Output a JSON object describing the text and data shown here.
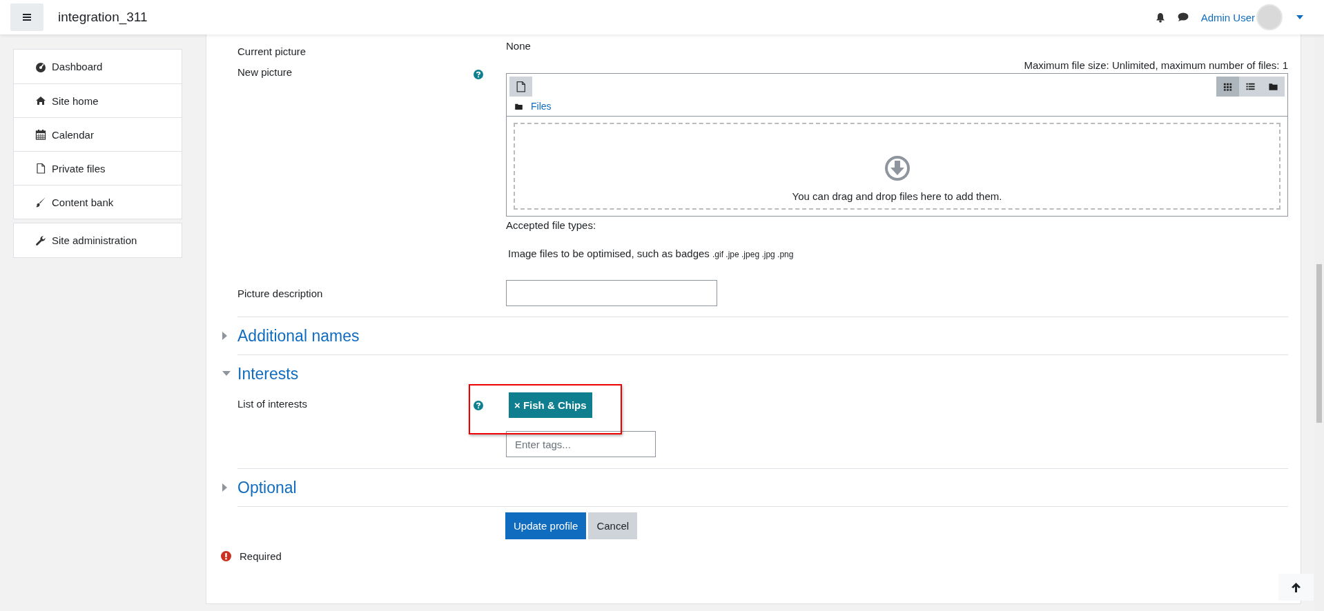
{
  "navbar": {
    "site_name": "integration_311",
    "user_name": "Admin User"
  },
  "sidebar": {
    "groups": [
      [
        {
          "label": "Dashboard",
          "kind": "dashboard"
        },
        {
          "label": "Site home",
          "kind": "home"
        },
        {
          "label": "Calendar",
          "kind": "calendar"
        },
        {
          "label": "Private files",
          "kind": "file"
        },
        {
          "label": "Content bank",
          "kind": "brush"
        }
      ],
      [
        {
          "label": "Site administration",
          "kind": "wrench"
        }
      ]
    ]
  },
  "form": {
    "current_picture": {
      "label": "Current picture",
      "value": "None"
    },
    "new_picture": {
      "label": "New picture",
      "limits": "Maximum file size: Unlimited, maximum number of files: 1",
      "breadcrumb": "Files",
      "view_modes": [
        {
          "kind": "grid",
          "selected": true
        },
        {
          "kind": "list",
          "selected": false
        },
        {
          "kind": "tree",
          "selected": false
        }
      ],
      "drop_text": "You can drag and drop files here to add them.",
      "accepted_label": "Accepted file types:",
      "accepted_types": "Image files to be optimised, such as badges",
      "extensions": ".gif .jpe .jpeg .jpg .png"
    },
    "picture_description": {
      "label": "Picture description"
    },
    "sections": [
      {
        "title": "Additional names",
        "expanded": false
      },
      {
        "title": "Interests",
        "expanded": true,
        "field": {
          "label": "List of interests",
          "tags": [
            {
              "remove": "×",
              "label": "Fish & Chips"
            }
          ],
          "placeholder": "Enter tags...",
          "highlighted": true
        }
      },
      {
        "title": "Optional",
        "expanded": false
      }
    ],
    "buttons": [
      {
        "label": "Update profile",
        "kind": "primary"
      },
      {
        "label": "Cancel",
        "kind": "secondary"
      }
    ],
    "required_note": "Required"
  }
}
